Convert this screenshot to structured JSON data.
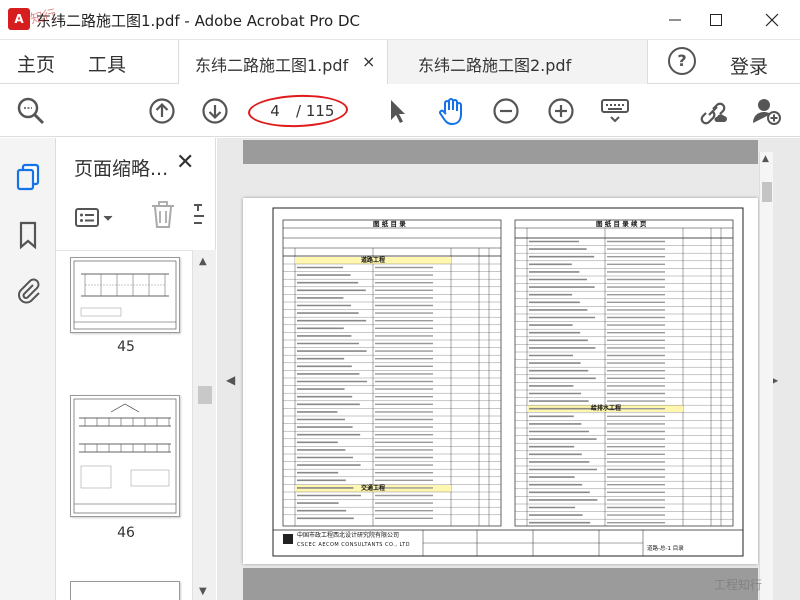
{
  "window": {
    "title": "东纬二路施工图1.pdf - Adobe Acrobat Pro DC"
  },
  "nav": {
    "home": "主页",
    "tools": "工具",
    "help": "?",
    "login": "登录"
  },
  "tabs": [
    {
      "label": "东纬二路施工图1.pdf",
      "active": true,
      "close": "×"
    },
    {
      "label": "东纬二路施工图2.pdf",
      "active": false
    }
  ],
  "toolbar": {
    "current_page": "4",
    "total_pages": "/ 115",
    "icons": [
      "search-zoom-icon",
      "prev-page-icon",
      "next-page-icon",
      "select-cursor-icon",
      "hand-tool-icon",
      "zoom-out-icon",
      "zoom-in-icon",
      "keyboard-icon",
      "share-link-icon",
      "add-user-icon"
    ]
  },
  "left_rail": {
    "icons": [
      "page-thumbnails-icon",
      "bookmarks-icon",
      "attachments-icon"
    ]
  },
  "thumb_panel": {
    "title": "页面缩略...",
    "close": "✕",
    "pages": [
      {
        "number": "45"
      },
      {
        "number": "46"
      }
    ]
  },
  "document": {
    "left_title": "图 纸 目 录",
    "right_title": "图 纸 目 录 续 页",
    "company": "中国市政工程西北设计研究院有限公司",
    "company_en": "CSCEC AECOM CONSULTANTS CO., LTD",
    "section_road": "道路工程",
    "section_traffic": "交通工程",
    "section_drain": "给排水工程",
    "sheet_title": "道路-总-1 目录"
  },
  "colors": {
    "accent_red": "#e01b1b",
    "icon_blue": "#1473e6",
    "doc_bg": "#e9e9e9"
  },
  "watermark": {
    "top": "知行",
    "bottom": "工程知行"
  }
}
